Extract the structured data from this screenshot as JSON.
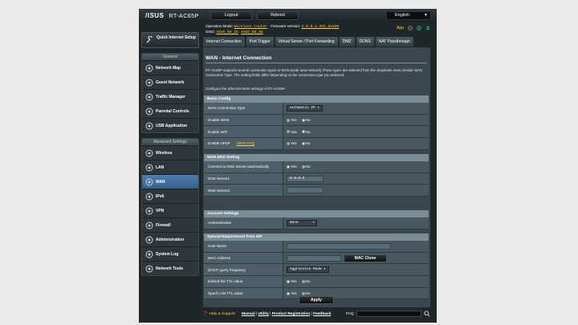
{
  "header": {
    "brand": "/ISUS",
    "model": "RT-AC65P",
    "logout_label": "Logout",
    "reboot_label": "Reboot",
    "language": "English"
  },
  "info": {
    "op_mode_label": "Operation Mode:",
    "op_mode_value": "Wireless router",
    "fw_label": "Firmware Version:",
    "fw_value": "3.0.0.4.382_51599",
    "ssid_label": "SSID:",
    "ssid_1": "ASUS_B8_2G",
    "ssid_2": "ASUS_B8_5G",
    "app_label": "App"
  },
  "sidebar": {
    "quick_setup": "Quick Internet Setup",
    "general_title": "General",
    "general": [
      {
        "label": "Network Map",
        "icon": "network-map-icon"
      },
      {
        "label": "Guest Network",
        "icon": "guest-network-icon"
      },
      {
        "label": "Traffic Manager",
        "icon": "traffic-manager-icon"
      },
      {
        "label": "Parental Controls",
        "icon": "parental-controls-icon"
      },
      {
        "label": "USB Application",
        "icon": "usb-icon"
      }
    ],
    "advanced_title": "Advanced Settings",
    "advanced": [
      {
        "label": "Wireless",
        "icon": "wireless-icon"
      },
      {
        "label": "LAN",
        "icon": "lan-icon"
      },
      {
        "label": "WAN",
        "icon": "wan-icon"
      },
      {
        "label": "IPv6",
        "icon": "ipv6-icon"
      },
      {
        "label": "VPN",
        "icon": "vpn-icon"
      },
      {
        "label": "Firewall",
        "icon": "firewall-icon"
      },
      {
        "label": "Administration",
        "icon": "administration-icon"
      },
      {
        "label": "System Log",
        "icon": "system-log-icon"
      },
      {
        "label": "Network Tools",
        "icon": "network-tools-icon"
      }
    ]
  },
  "tabs": [
    "Internet Connection",
    "Port Trigger",
    "Virtual Server / Port Forwarding",
    "DMZ",
    "DDNS",
    "NAT Passthrough"
  ],
  "main": {
    "title": "WAN - Internet Connection",
    "description": "RT-AC65P supports several connection types to WAN (wide area network).These types are selected from the dropdown menu beside WAN Connection Type. The setting fields differ depending on the connection type you selected.",
    "configure_text": "Configure the Ethernet WAN settings of RT-AC65P.",
    "basic_config": {
      "title": "Basic Config",
      "wan_type_label": "WAN Connection Type",
      "wan_type_value": "Automatic IP",
      "enable_wan_label": "Enable WAN",
      "enable_nat_label": "Enable NAT",
      "enable_upnp_label": "Enable UPnP",
      "upnp_faq": "UPnP  FAQ"
    },
    "dns": {
      "title": "WAN DNS Setting",
      "auto_dns_label": "Connect to DNS Server automatically",
      "dns1_label": "DNS Server1",
      "dns1_value": "8.8.8.8",
      "dns2_label": "DNS Server2",
      "dns2_value": ""
    },
    "account": {
      "title": "Account Settings",
      "auth_label": "Authentication",
      "auth_value": "None"
    },
    "isp": {
      "title": "Special Requirement from ISP",
      "host_label": "Host Name",
      "mac_label": "MAC Address",
      "mac_clone": "MAC Clone",
      "dhcp_label": "DHCP query frequency",
      "dhcp_value": "Aggressive Mode",
      "ttl_label": "Extend the TTL value",
      "spoof_label": "Spoof LAN TTL value"
    },
    "yes": "Yes",
    "no": "No",
    "apply": "Apply"
  },
  "footer": {
    "help": "Help & Support",
    "manual": "Manual",
    "utility": "Utility",
    "product_registration": "Product Registration",
    "feedback": "Feedback",
    "sep": "|",
    "faq": "FAQ"
  }
}
